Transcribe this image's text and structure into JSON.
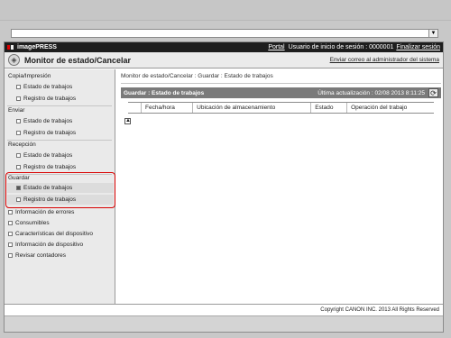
{
  "address_bar": {
    "value": ""
  },
  "header": {
    "brand": "imagePRESS",
    "portal_link": "Portal",
    "user_label": "Usuario de inicio de sesión : 0000001",
    "logout_link": "Finalizar sesión"
  },
  "titlebar": {
    "title": "Monitor de estado/Cancelar",
    "email_link": "Enviar correo al administrador del sistema"
  },
  "sidebar": {
    "copy_print": {
      "heading": "Copia/Impresión",
      "items": [
        "Estado de trabajos",
        "Registro de trabajos"
      ]
    },
    "send": {
      "heading": "Enviar",
      "items": [
        "Estado de trabajos",
        "Registro de trabajos"
      ]
    },
    "receive": {
      "heading": "Recepción",
      "items": [
        "Estado de trabajos",
        "Registro de trabajos"
      ]
    },
    "store": {
      "heading": "Guardar",
      "items": [
        "Estado de trabajos",
        "Registro de trabajos"
      ]
    },
    "top_items": [
      "Información de errores",
      "Consumibles",
      "Características del dispositivo",
      "Información de dispositivo",
      "Revisar contadores"
    ]
  },
  "main": {
    "breadcrumb": "Monitor de estado/Cancelar : Guardar : Estado de trabajos",
    "panel_title": "Guardar : Estado de trabajos",
    "last_update": "Última actualización : 02/08 2013 8:11:25",
    "columns": [
      "Fecha/hora",
      "Ubicación de almacenamiento",
      "Estado",
      "Operación del trabajo"
    ]
  },
  "footer": {
    "copyright": "Copyright CANON INC. 2013 All Rights Reserved"
  },
  "colors": {
    "highlight_border": "#d80000",
    "header_bg": "#1e1e1e",
    "panel_head_bg": "#7a7a7a"
  }
}
